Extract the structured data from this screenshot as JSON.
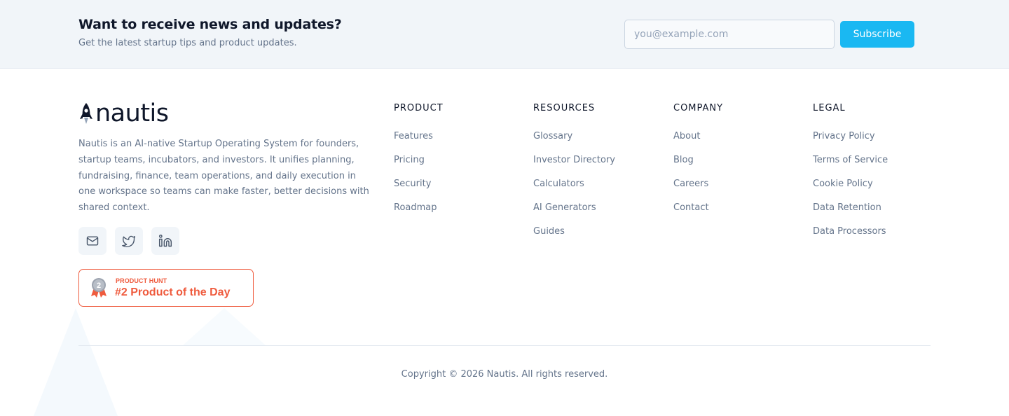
{
  "newsletter": {
    "title": "Want to receive news and updates?",
    "subtitle": "Get the latest startup tips and product updates.",
    "email_placeholder": "you@example.com",
    "subscribe_label": "Subscribe"
  },
  "brand": {
    "name": "nautis",
    "description": "Nautis is an AI-native Startup Operating System for founders, startup teams, incubators, and investors. It unifies planning, fundraising, finance, team operations, and daily execution in one workspace so teams can make faster, better decisions with shared context."
  },
  "social": [
    {
      "icon": "mail-icon"
    },
    {
      "icon": "twitter-icon"
    },
    {
      "icon": "linkedin-icon"
    }
  ],
  "badge": {
    "rank": "2",
    "small": "PRODUCT HUNT",
    "big": "#2 Product of the Day"
  },
  "columns": [
    {
      "heading": "PRODUCT",
      "links": [
        "Features",
        "Pricing",
        "Security",
        "Roadmap"
      ]
    },
    {
      "heading": "RESOURCES",
      "links": [
        "Glossary",
        "Investor Directory",
        "Calculators",
        "AI Generators",
        "Guides"
      ]
    },
    {
      "heading": "COMPANY",
      "links": [
        "About",
        "Blog",
        "Careers",
        "Contact"
      ]
    },
    {
      "heading": "LEGAL",
      "links": [
        "Privacy Policy",
        "Terms of Service",
        "Cookie Policy",
        "Data Retention",
        "Data Processors"
      ]
    }
  ],
  "copyright": "Copyright © 2026 Nautis. All rights reserved.",
  "colors": {
    "accent": "#1ab8f2",
    "badge": "#ef5b3e",
    "text_dark": "#0f172a",
    "text_muted": "#64748b",
    "band_bg": "#f1f5f9"
  }
}
